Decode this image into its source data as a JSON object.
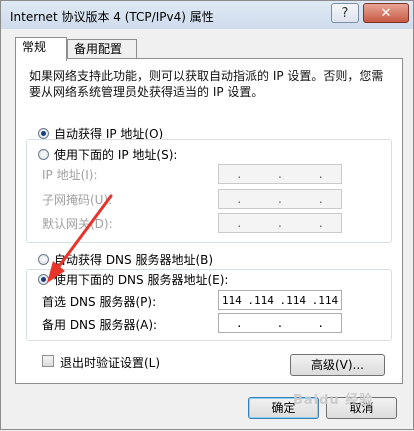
{
  "window": {
    "title": "Internet 协议版本 4 (TCP/IPv4) 属性",
    "help_symbol": "?",
    "close_symbol": "✕"
  },
  "tabs": [
    {
      "label": "常规",
      "active": true
    },
    {
      "label": "备用配置",
      "active": false
    }
  ],
  "description": "如果网络支持此功能，则可以获取自动指派的 IP 设置。否则，您需要从网络系统管理员处获得适当的 IP 设置。",
  "ip": {
    "auto_label": "自动获得 IP 地址(O)",
    "manual_label": "使用下面的 IP 地址(S):",
    "fields": [
      {
        "label": "IP 地址(I):",
        "value": [
          ".",
          ".",
          "."
        ]
      },
      {
        "label": "子网掩码(U):",
        "value": [
          ".",
          ".",
          "."
        ]
      },
      {
        "label": "默认网关(D):",
        "value": [
          ".",
          ".",
          "."
        ]
      }
    ]
  },
  "dns": {
    "auto_label": "自动获得 DNS 服务器地址(B)",
    "manual_label": "使用下面的 DNS 服务器地址(E):",
    "preferred_label": "首选 DNS 服务器(P):",
    "preferred_value": [
      "114",
      ".114",
      ".114",
      ".114"
    ],
    "alternate_label": "备用 DNS 服务器(A):",
    "alternate_value": [
      ".",
      ".",
      "."
    ]
  },
  "validate_label": "退出时验证设置(L)",
  "advanced_label": "高级(V)...",
  "ok_label": "确定",
  "cancel_label": "取消",
  "watermark": "Baidu 经验",
  "colors": {
    "accent_arrow": "#e8332a",
    "title_bar": "#dfe9f5"
  }
}
